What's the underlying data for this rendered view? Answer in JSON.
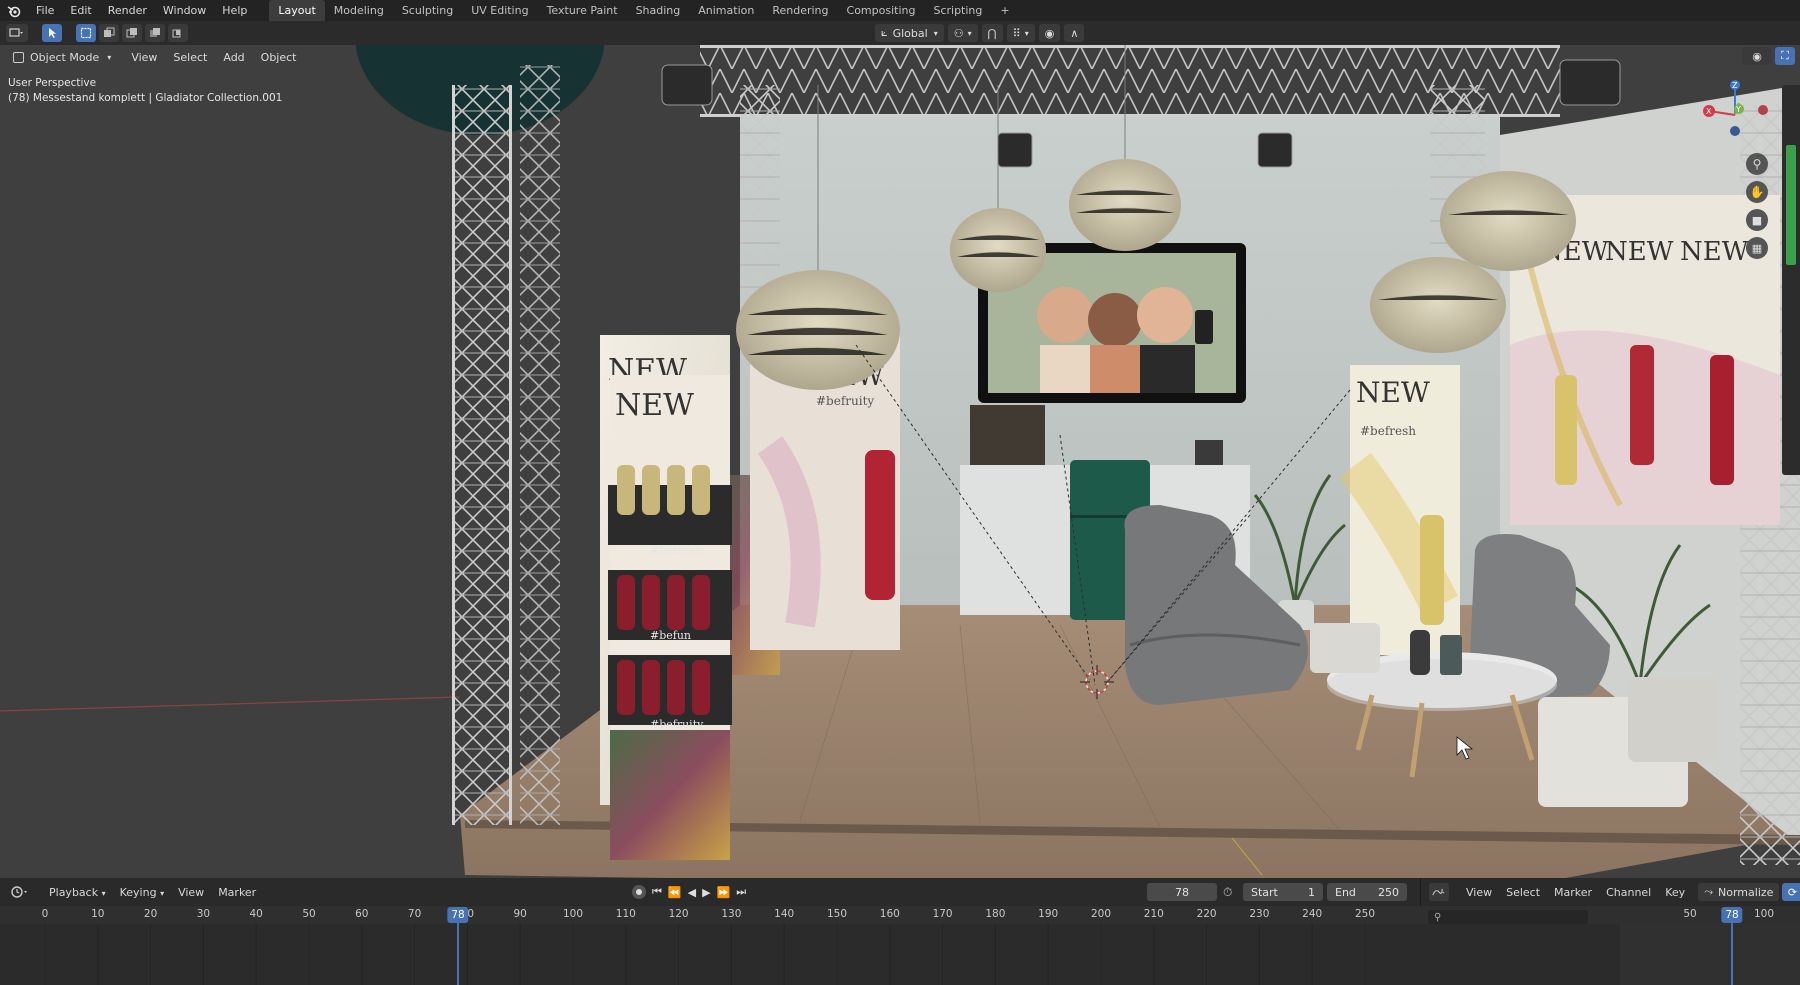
{
  "topbar": {
    "menus": [
      "File",
      "Edit",
      "Render",
      "Window",
      "Help"
    ],
    "workspaces": [
      "Layout",
      "Modeling",
      "Sculpting",
      "UV Editing",
      "Texture Paint",
      "Shading",
      "Animation",
      "Rendering",
      "Compositing",
      "Scripting"
    ],
    "active_workspace": "Layout",
    "add_tab": "+"
  },
  "toolheader": {
    "orientation": "Global"
  },
  "viewport_header": {
    "mode": "Object Mode",
    "menus": [
      "View",
      "Select",
      "Add",
      "Object"
    ]
  },
  "viewport": {
    "perspective_label": "User Perspective",
    "collection_label": "(78) Messestand komplett | Gladiator Collection.001",
    "scene_text": {
      "new": "NEW",
      "tag_befresh": "#befresh",
      "tag_befun": "#befun",
      "tag_befruity": "#befruity"
    },
    "gizmo": {
      "x": "X",
      "y": "Y",
      "z": "Z"
    }
  },
  "timeline": {
    "menus": [
      "Playback",
      "Keying",
      "View",
      "Marker"
    ],
    "current_frame": "78",
    "start_label": "Start",
    "start_value": "1",
    "end_label": "End",
    "end_value": "250",
    "ticks": [
      "0",
      "10",
      "20",
      "30",
      "40",
      "50",
      "60",
      "70",
      "80",
      "90",
      "100",
      "110",
      "120",
      "130",
      "140",
      "150",
      "160",
      "170",
      "180",
      "190",
      "200",
      "210",
      "220",
      "230",
      "240",
      "250"
    ],
    "playhead_label": "78"
  },
  "graph_editor": {
    "menus": [
      "View",
      "Select",
      "Marker",
      "Channel",
      "Key"
    ],
    "normalize_label": "Normalize",
    "ticks": [
      "50",
      "100"
    ],
    "playhead_label": "78"
  }
}
